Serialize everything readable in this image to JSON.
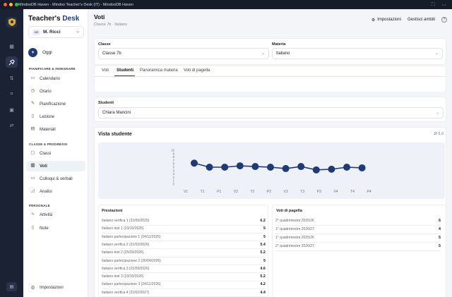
{
  "window": {
    "title": "MindooDB Haven - Mindoo Teacher's Desk (IT) - MindooDB Haven"
  },
  "sidebar": {
    "brand_prefix": "Teacher's",
    "brand_suffix": "Desk",
    "user": {
      "initials": "MR",
      "name": "M. Ricci"
    },
    "today_label": "Oggi",
    "sections": {
      "plan": "PIANIFICARE & INSEGNARE",
      "classes": "CLASSE & PROGRESSI",
      "personal": "PERSONALE"
    },
    "items": [
      {
        "label": "Calendario",
        "icon": "calendar-icon"
      },
      {
        "label": "Orario",
        "icon": "clock-icon"
      },
      {
        "label": "Pianificazione",
        "icon": "planning-icon"
      },
      {
        "label": "Lezione",
        "icon": "lesson-icon"
      },
      {
        "label": "Materiali",
        "icon": "folder-icon"
      },
      {
        "label": "Classi",
        "icon": "classes-icon"
      },
      {
        "label": "Voti",
        "icon": "grades-icon"
      },
      {
        "label": "Colloqui & verbali",
        "icon": "chat-icon"
      },
      {
        "label": "Analisi",
        "icon": "analytics-icon"
      },
      {
        "label": "Attività",
        "icon": "activity-icon"
      },
      {
        "label": "Note",
        "icon": "note-icon"
      }
    ],
    "settings_label": "Impostazioni"
  },
  "header": {
    "title": "Voti",
    "subtitle": "Classe 7b · Italiano",
    "settings_button": "Impostazioni",
    "manage_button": "Gestisci ambiti"
  },
  "filters": {
    "class_label": "Classe",
    "class_value": "Classe 7b",
    "subject_label": "Materia",
    "subject_value": "Italiano"
  },
  "tabs": [
    "Voti",
    "Studenti",
    "Panoramica materia",
    "Voti di pagella"
  ],
  "active_tab": "Studenti",
  "student": {
    "label": "Studenti",
    "value": "Chiara Mancini"
  },
  "student_view": {
    "title": "Vista studente",
    "average": "Ø 5,0"
  },
  "chart_data": {
    "type": "line",
    "x": [
      "V1",
      "T1",
      "P1",
      "V2",
      "T2",
      "P2",
      "V3",
      "T3",
      "P3",
      "V4",
      "T4",
      "P4"
    ],
    "y_ticks": [
      10,
      9,
      8,
      7,
      6,
      5,
      4,
      3,
      2,
      1,
      0
    ],
    "ylim": [
      0,
      10
    ],
    "series": [
      {
        "values": [
          6.2,
          5,
          5,
          5.4,
          5.2,
          5,
          4.6,
          5.2,
          4.2,
          4.4,
          5,
          4.8
        ]
      }
    ],
    "color": "#1f3a75",
    "grid": false
  },
  "performances": {
    "title": "Prestazioni",
    "rows": [
      {
        "label": "Italiano verifica 1 (21/09/2025)",
        "value": "6.2"
      },
      {
        "label": "Italiano test 1 (23/10/2025)",
        "value": "5"
      },
      {
        "label": "Italiano partecipazione 1 (24/11/2025)",
        "value": "5"
      },
      {
        "label": "Italiano verifica 2 (21/02/2026)",
        "value": "5.4"
      },
      {
        "label": "Italiano test 2 (25/03/2026)",
        "value": "5.2"
      },
      {
        "label": "Italiano partecipazione 2 (26/04/2026)",
        "value": "5"
      },
      {
        "label": "Italiano verifica 3 (21/09/2026)",
        "value": "4.6"
      },
      {
        "label": "Italiano test 3 (23/10/2026)",
        "value": "5.2"
      },
      {
        "label": "Italiano partecipazione 3 (24/11/2026)",
        "value": "4.2"
      },
      {
        "label": "Italiano verifica 4 (21/02/2027)",
        "value": "4.4"
      }
    ]
  },
  "report_grades": {
    "title": "Voti di pagella",
    "rows": [
      {
        "label": "2° quadrimestre 2025/26",
        "value": "6"
      },
      {
        "label": "1° quadrimestre 2026/27",
        "value": "4"
      },
      {
        "label": "1° quadrimestre 2025/26",
        "value": "5"
      },
      {
        "label": "2° quadrimestre 2026/27",
        "value": "5"
      }
    ]
  }
}
